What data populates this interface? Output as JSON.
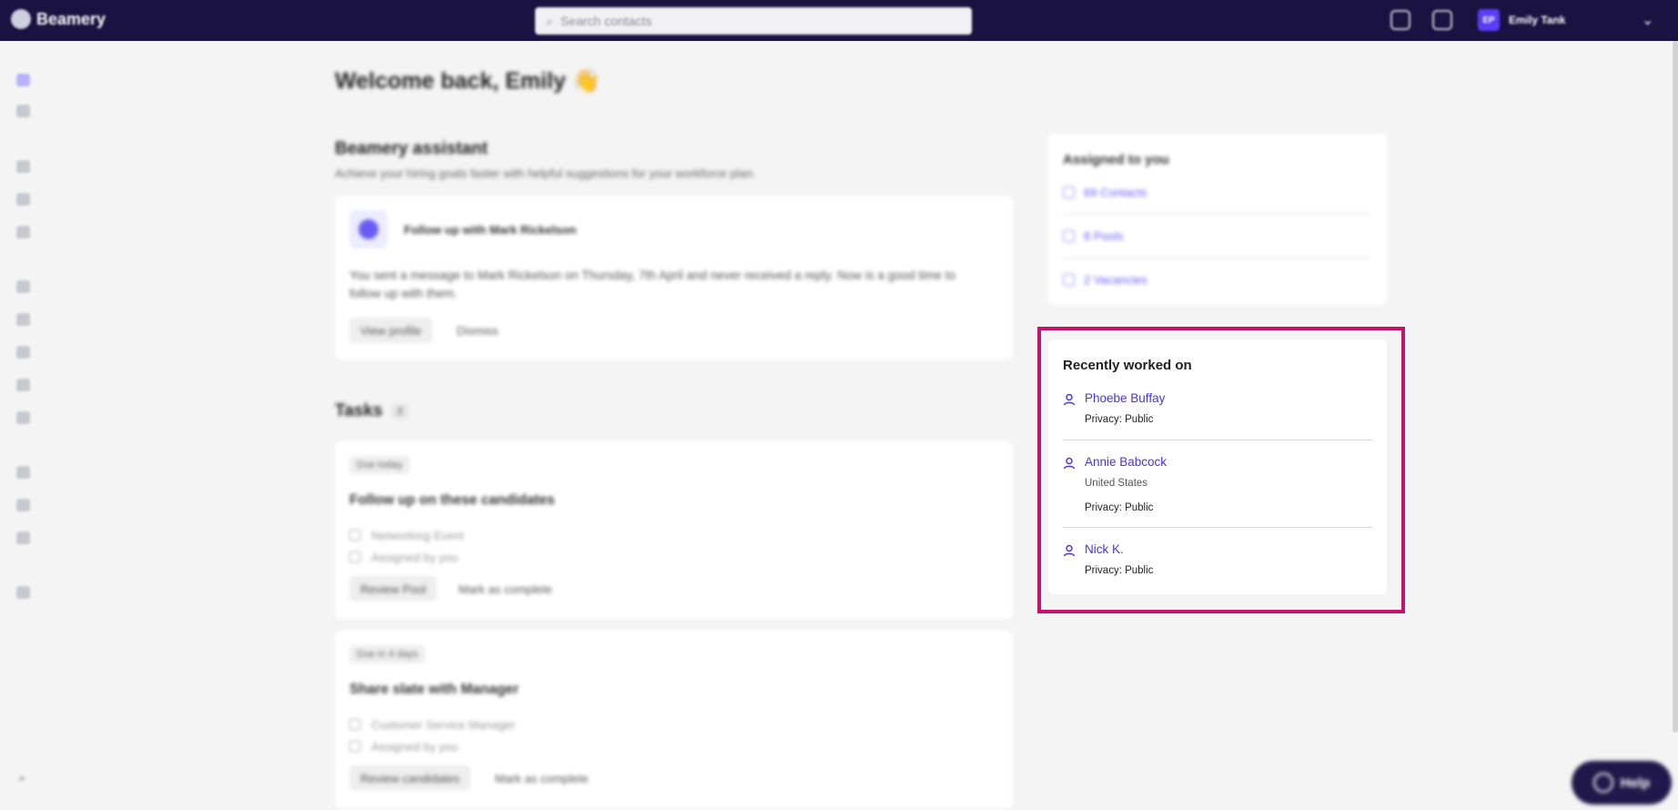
{
  "app": {
    "name": "Beamery"
  },
  "search": {
    "placeholder": "Search contacts"
  },
  "user": {
    "initials": "EP",
    "name": "Emily Tank"
  },
  "welcome": {
    "title": "Welcome back, Emily 👋"
  },
  "assistant": {
    "title": "Beamery assistant",
    "subtitle": "Achieve your hiring goals faster with helpful suggestions for your workforce plan.",
    "card_title": "Follow up with Mark Rickelson",
    "card_text": "You sent a message to Mark Rickelson on Thursday, 7th April and never received a reply. Now is a good time to follow up with them.",
    "primary_button": "View profile",
    "secondary_button": "Dismiss"
  },
  "tasks": {
    "title": "Tasks",
    "count": "2",
    "items": [
      {
        "badge": "Due today",
        "title": "Follow up on these candidates",
        "meta1": "Networking Event",
        "meta2": "Assigned by you",
        "primary_button": "Review Pool",
        "secondary_button": "Mark as complete"
      },
      {
        "badge": "Due in 4 days",
        "title": "Share slate with Manager",
        "meta1": "Customer Service Manager",
        "meta2": "Assigned by you",
        "primary_button": "Review candidates",
        "secondary_button": "Mark as complete"
      }
    ]
  },
  "assigned": {
    "title": "Assigned to you",
    "items": [
      {
        "label": "69 Contacts",
        "icon": "person-icon"
      },
      {
        "label": "8 Pools",
        "icon": "folder-icon"
      },
      {
        "label": "2 Vacancies",
        "icon": "briefcase-icon"
      }
    ]
  },
  "recent": {
    "title": "Recently worked on",
    "items": [
      {
        "name": "Phoebe Buffay",
        "location": "",
        "privacy": "Privacy: Public"
      },
      {
        "name": "Annie Babcock",
        "location": "United States",
        "privacy": "Privacy: Public"
      },
      {
        "name": "Nick K.",
        "location": "",
        "privacy": "Privacy: Public"
      }
    ]
  },
  "help": {
    "label": "Help"
  },
  "colors": {
    "topbar": "#1a1240",
    "accent": "#4a33d9",
    "highlight": "#c4136a"
  }
}
